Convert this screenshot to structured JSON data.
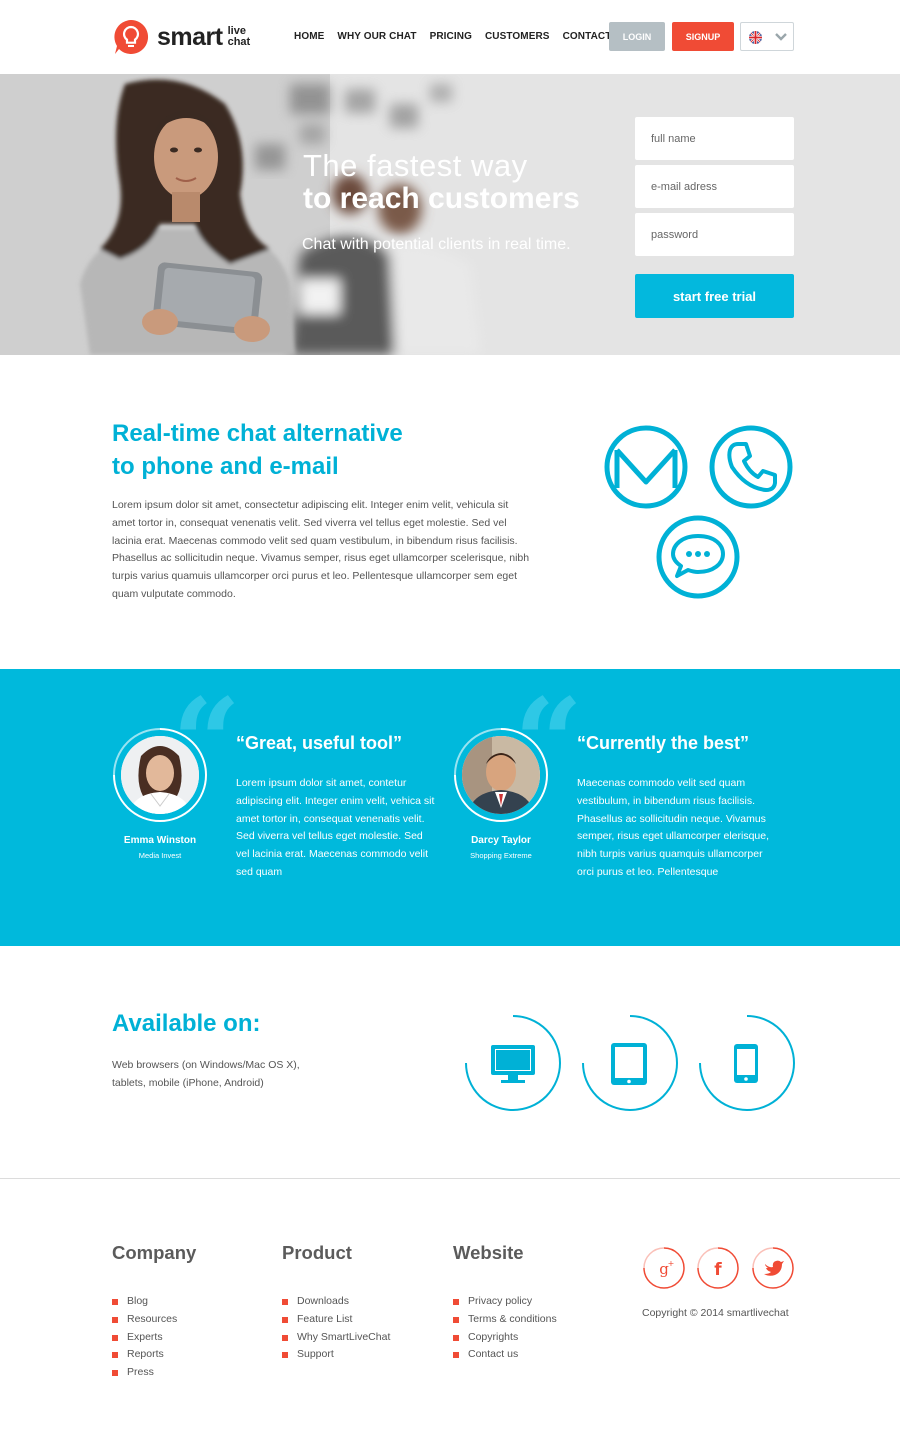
{
  "header": {
    "logo_main": "smart",
    "logo_sub_1": "live",
    "logo_sub_2": "chat",
    "nav": [
      "HOME",
      "WHY OUR CHAT",
      "PRICING",
      "CUSTOMERS",
      "CONTACT"
    ],
    "login_label": "LOGIN",
    "signup_label": "SIGNUP"
  },
  "hero": {
    "title_line1": "The fastest way",
    "title_line2": "to reach customers",
    "subtitle": "Chat with potential clients in real time.",
    "fields": {
      "full_name_placeholder": "full name",
      "email_placeholder": "e-mail adress",
      "password_placeholder": "password"
    },
    "cta_label": "start free trial"
  },
  "feature": {
    "title_line1": "Real-time chat alternative",
    "title_line2": "to phone and e-mail",
    "text": "Lorem ipsum dolor sit amet, consectetur adipiscing elit. Integer enim velit, vehicula sit amet tortor in, consequat venenatis velit. Sed viverra vel tellus eget molestie. Sed vel lacinia erat. Maecenas commodo velit sed quam vestibulum, in bibendum risus facilisis. Phasellus ac sollicitudin neque. Vivamus semper, risus eget ullamcorper scelerisque, nibh turpis varius quamuis ullamcorper orci purus et leo. Pellentesque ullamcorper sem eget quam vulputate commodo.",
    "icons": [
      "mail-icon",
      "phone-icon",
      "chat-bubble-icon"
    ]
  },
  "testimonials": [
    {
      "name": "Emma Winston",
      "role": "Media Invest",
      "title": "“Great, useful tool”",
      "text": "Lorem ipsum dolor sit amet, contetur adipiscing elit. Integer enim velit, vehica sit amet tortor in, consequat venenatis velit. Sed viverra vel tellus eget molestie. Sed vel lacinia erat. Maecenas commodo velit sed quam"
    },
    {
      "name": "Darcy Taylor",
      "role": "Shopping Extreme",
      "title": "“Currently the best”",
      "text": "Maecenas commodo velit sed quam vestibulum, in bibendum risus facilisis. Phasellus ac sollicitudin neque. Vivamus semper, risus eget ullamcorper elerisque, nibh turpis varius quamquis ullamcorper orci purus et leo. Pellentesque"
    }
  ],
  "available": {
    "title": "Available on:",
    "text": "Web browsers (on Windows/Mac OS X), tablets, mobile (iPhone, Android)",
    "devices": [
      "desktop-icon",
      "tablet-icon",
      "mobile-icon"
    ]
  },
  "footer": {
    "columns": [
      {
        "heading": "Company",
        "items": [
          "Blog",
          "Resources",
          "Experts",
          "Reports",
          "Press"
        ]
      },
      {
        "heading": "Product",
        "items": [
          "Downloads",
          "Feature List",
          "Why SmartLiveChat",
          "Support"
        ]
      },
      {
        "heading": "Website",
        "items": [
          "Privacy policy",
          "Terms & conditions",
          "Copyrights",
          "Contact us"
        ]
      }
    ],
    "social": [
      "google-plus-icon",
      "facebook-icon",
      "twitter-icon"
    ],
    "copyright": "Copyright © 2014 smartlivechat"
  },
  "colors": {
    "accent": "#00b9dc",
    "brand_red": "#f04b35",
    "login_grey": "#b5bfc4"
  }
}
